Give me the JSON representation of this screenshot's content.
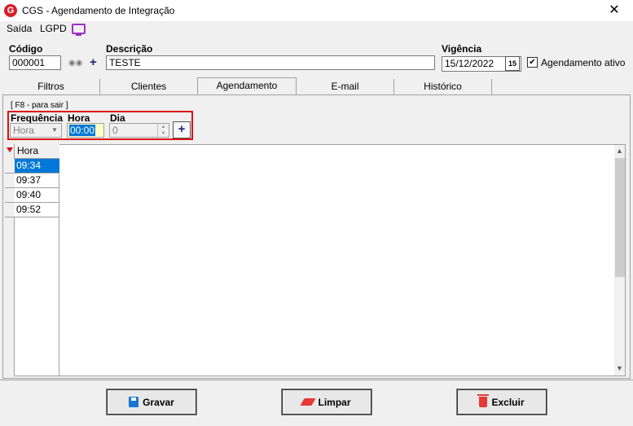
{
  "window": {
    "title": "CGS - Agendamento de Integração",
    "close_glyph": "✕"
  },
  "menu": {
    "items": [
      "Saída",
      "LGPD"
    ]
  },
  "header": {
    "codigo_label": "Código",
    "codigo_value": "000001",
    "descricao_label": "Descrição",
    "descricao_value": "TESTE",
    "vigencia_label": "Vigência",
    "vigencia_value": "15/12/2022",
    "calendar_glyph": "15",
    "agendamento_ativo_label": "Agendamento ativo",
    "agendamento_ativo_checked": true
  },
  "tabs": [
    {
      "label": "Filtros"
    },
    {
      "label": "Clientes"
    },
    {
      "label": "Agendamento",
      "active": true
    },
    {
      "label": "E-mail"
    },
    {
      "label": "Histórico"
    }
  ],
  "schedule": {
    "hint": "[ F8 - para sair ]",
    "frequencia_label": "Frequência",
    "frequencia_value": "Hora",
    "hora_label": "Hora",
    "hora_value": "00:00",
    "dia_label": "Dia",
    "dia_value": "0"
  },
  "grid": {
    "column_header": "Hora",
    "rows": [
      "09:34",
      "09:37",
      "09:40",
      "09:52"
    ],
    "selected_index": 0
  },
  "buttons": {
    "gravar": "Gravar",
    "limpar": "Limpar",
    "excluir": "Excluir"
  },
  "colors": {
    "highlight_box": "#e01010",
    "selection": "#0078d7",
    "accent_icon": "#1a237e"
  }
}
